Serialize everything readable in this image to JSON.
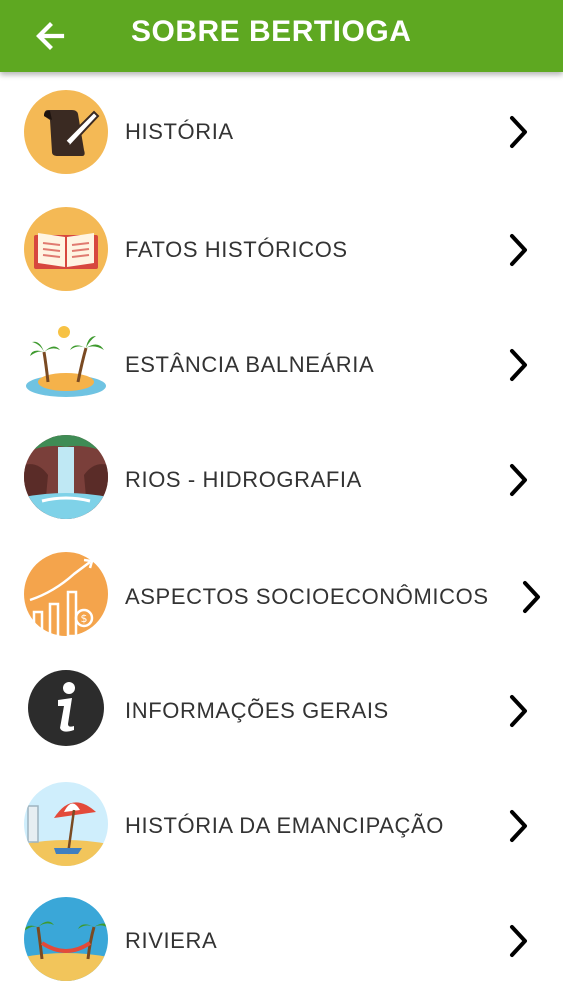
{
  "header": {
    "title": "SOBRE BERTIOGA",
    "back_icon": "arrow-left-icon",
    "color": "#5ea821"
  },
  "menu": {
    "items": [
      {
        "label": "HISTÓRIA",
        "icon": "scroll-quill-icon"
      },
      {
        "label": "FATOS HISTÓRICOS",
        "icon": "open-book-icon"
      },
      {
        "label": "ESTÂNCIA BALNEÁRIA",
        "icon": "palm-island-icon"
      },
      {
        "label": "RIOS - HIDROGRAFIA",
        "icon": "waterfall-icon"
      },
      {
        "label": "ASPECTOS SOCIOECONÔMICOS",
        "icon": "growth-chart-icon"
      },
      {
        "label": "INFORMAÇÕES GERAIS",
        "icon": "info-icon"
      },
      {
        "label": "HISTÓRIA DA EMANCIPAÇÃO",
        "icon": "beach-umbrella-icon"
      },
      {
        "label": "RIVIERA",
        "icon": "beach-hammock-icon"
      }
    ],
    "chevron_icon": "chevron-right-icon"
  }
}
